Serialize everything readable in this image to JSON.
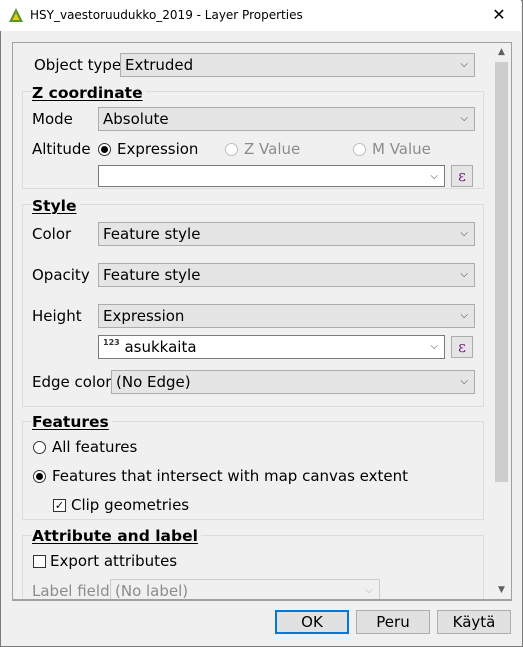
{
  "window": {
    "title": "HSY_vaestoruudukko_2019 - Layer Properties",
    "close_glyph": "✕"
  },
  "object_type": {
    "label": "Object type",
    "value": "Extruded"
  },
  "z_coordinate": {
    "title": "Z coordinate",
    "mode_label": "Mode",
    "mode_value": "Absolute",
    "altitude_label": "Altitude",
    "options": [
      {
        "label": "Expression",
        "checked": true,
        "enabled": true
      },
      {
        "label": "Z Value",
        "checked": false,
        "enabled": false
      },
      {
        "label": "M Value",
        "checked": false,
        "enabled": false
      }
    ],
    "expression_value": "",
    "expression_button": "ε"
  },
  "style": {
    "title": "Style",
    "color_label": "Color",
    "color_value": "Feature style",
    "opacity_label": "Opacity",
    "opacity_value": "Feature style",
    "height_label": "Height",
    "height_value": "Expression",
    "height_field_type": "123",
    "height_field_value": "asukkaita",
    "expression_button": "ε",
    "edge_color_label": "Edge color",
    "edge_color_value": "(No Edge)"
  },
  "features": {
    "title": "Features",
    "all_features": "All features",
    "intersect": "Features that intersect with map canvas extent",
    "clip": "Clip geometries",
    "clip_check": "☑"
  },
  "attribute_and_label": {
    "title": "Attribute and label",
    "export_attributes": "Export attributes",
    "label_field_label": "Label field",
    "label_field_value": "(No label)"
  },
  "buttons": {
    "ok": "OK",
    "cancel": "Peru",
    "apply": "Käytä"
  },
  "icons": {
    "chevron": "⌵",
    "scroll_up": "▲",
    "scroll_down": "▼"
  },
  "colors": {
    "accent": "#0078d7",
    "epsilon": "#7b1e7a",
    "qgis_green": "#589632",
    "qgis_yellow": "#f0c419"
  }
}
